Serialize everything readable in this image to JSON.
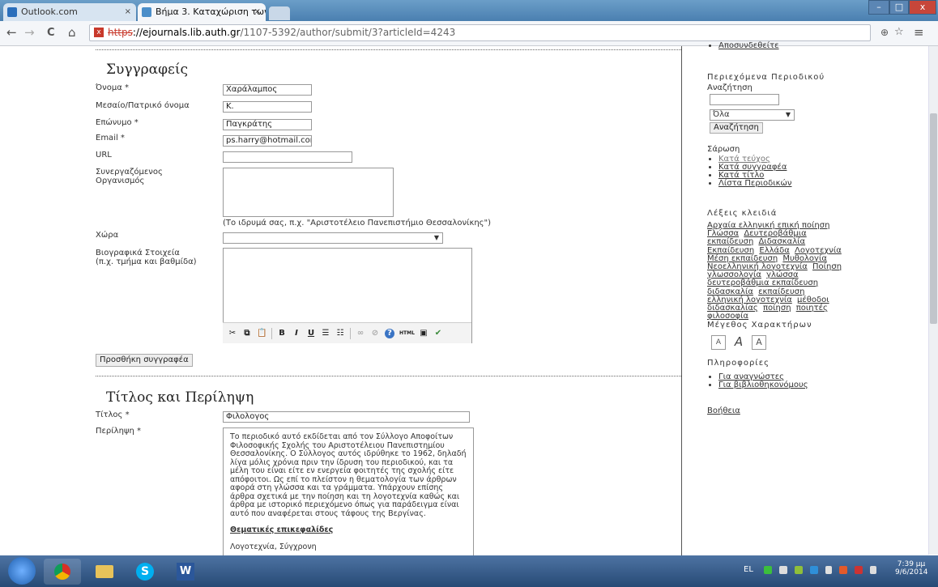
{
  "browser": {
    "tabs": [
      {
        "label": "Outlook.com",
        "close": "×"
      },
      {
        "label": "Βήμα 3. Καταχώριση των",
        "close": "×"
      }
    ],
    "url": {
      "scheme": "https",
      "rest_host": "://ejournals.lib.auth.gr",
      "path": "/1107-5392/author/submit/3?articleId=4243"
    },
    "nav": {
      "back": "←",
      "forward": "→",
      "reload": "C",
      "home": "⌂"
    },
    "window_controls": {
      "minimize": "–",
      "maximize": "□",
      "close": "x"
    },
    "zoom_icon": "⊕",
    "star_icon": "☆",
    "menu_icon": "≡"
  },
  "authors": {
    "heading": "Συγγραφείς",
    "first_name_label": "Όνομα *",
    "first_name_value": "Χαράλαμπος",
    "middle_name_label": "Μεσαίο/Πατρικό όνομα",
    "middle_name_value": "Κ.",
    "last_name_label": "Επώνυμο *",
    "last_name_value": "Παγκράτης",
    "email_label": "Email *",
    "email_value": "ps.harry@hotmail.com",
    "url_label": "URL",
    "url_value": "",
    "affiliation_label_1": "Συνεργαζόμενος",
    "affiliation_label_2": "Οργανισμός",
    "affiliation_hint": "(Το ιδρυμά σας, π.χ. \"Αριστοτέλειο Πανεπιστήμιο Θεσσαλονίκης\")",
    "country_label": "Χώρα",
    "country_value": "",
    "bio_label_1": "Βιογραφικά Στοιχεία",
    "bio_label_2": "(π.χ. τμήμα και βαθμίδα)",
    "add_author_button": "Προσθήκη συγγραφέα"
  },
  "editor_toolbar": {
    "cut": "✂",
    "copy": "⧉",
    "paste": "📋",
    "bold": "B",
    "italic": "I",
    "underline": "U",
    "bullets": "☰",
    "numbers": "☷",
    "link": "∞",
    "unlink": "⊘",
    "help": "?",
    "html": "HTML",
    "image": "▣",
    "spell": "✔"
  },
  "title_abstract": {
    "heading": "Τίτλος και Περίληψη",
    "title_label": "Τίτλος *",
    "title_value": "Φιλολογος",
    "abstract_label": "Περίληψη *",
    "abstract_text": "Το περιοδικό αυτό εκδίδεται από τον Σύλλογο Αποφοίτων Φιλοσοφικής Σχολής του Αριστοτέλειου Πανεπιστημίου Θεσσαλονίκης. Ο Σύλλογος αυτός ιδρύθηκε το 1962,  δηλαδή λίγα μόλις χρόνια πριν την ίδρυση του περιοδικού, και τα μέλη του είναι είτε εν ενεργεία φοιτητές της σχολής είτε απόφοιτοι. Ως επί το πλείστον η θεματολογία των άρθρων αφορά στη γλώσσα και τα γράμματα. Υπάρχουν επίσης άρθρα σχετικά με την ποίηση και τη λογοτεχνία καθώς και άρθρα με ιστορικό περιεχόμενο όπως για παράδειγμα είναι αυτό που αναφέρεται στους τάφους της Βεργίνας.",
    "thematic_heading": "Θεματικές επικεφαλίδες",
    "thematic_value": "Λογοτεχνία, Σύγχρονη"
  },
  "sidebar": {
    "top_link": "Αποσυνδεθείτε",
    "journal_contents_heading": "Περιεχόμενα Περιοδικού",
    "search_label": "Αναζήτηση",
    "search_value": "",
    "scope_value": "Όλα",
    "search_button": "Αναζήτηση",
    "browse_heading": "Σάρωση",
    "browse_links": [
      "Κατά τεύχος",
      "Κατά συγγραφέα",
      "Κατά τίτλο",
      "Λίστα Περιοδικών"
    ],
    "keywords_heading": "Λέξεις κλειδιά",
    "keywords": [
      "Αρχαία ελληνική επική ποίηση",
      "Γλώσσα",
      "Δευτεροβάθμια εκπαίδευση",
      "Διδασκαλία",
      "Εκπαίδευση",
      "Ελλάδα",
      "Λογοτεχνία",
      "Μέση εκπαίδευση",
      "Μυθολογία",
      "Νεοελληνική λογοτεχνία",
      "Ποίηση",
      "γλωσσολογία",
      "γλώσσα",
      "δευτεροβάθμια εκπαίδευση",
      "διδασκαλία",
      "εκπαίδευση",
      "ελληνική λογοτεχνία",
      "μέθοδοι διδασκαλίας",
      "ποίηση",
      "ποιητές",
      "φιλοσοφία"
    ],
    "font_size_heading": "Μέγεθος Χαρακτήρων",
    "font_buttons": [
      "A",
      "A",
      "A"
    ],
    "info_heading": "Πληροφορίες",
    "info_links": [
      "Για αναγνώστες",
      "Για βιβλιοθηκονόμους"
    ],
    "help_link": "Βοήθεια"
  },
  "taskbar": {
    "lang": "EL",
    "time": "7:39 μμ",
    "date": "9/6/2014"
  }
}
